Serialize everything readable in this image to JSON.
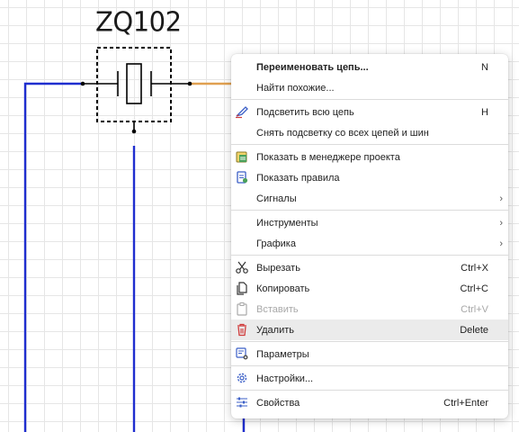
{
  "schematic": {
    "component_designator": "ZQ102",
    "wire_colors": {
      "primary": "#1f2ecf",
      "highlight": "#e0a050"
    }
  },
  "context_menu": {
    "groups": [
      [
        {
          "label": "Переименовать цепь...",
          "shortcut": "N",
          "icon": "",
          "bold": true
        },
        {
          "label": "Найти похожие...",
          "shortcut": "",
          "icon": ""
        }
      ],
      [
        {
          "label": "Подсветить всю цепь",
          "shortcut": "H",
          "icon": "highlighter-icon"
        },
        {
          "label": "Снять подсветку со всех цепей и шин",
          "shortcut": "",
          "icon": ""
        }
      ],
      [
        {
          "label": "Показать в менеджере проекта",
          "shortcut": "",
          "icon": "project-manager-icon"
        },
        {
          "label": "Показать правила",
          "shortcut": "",
          "icon": "rules-icon"
        },
        {
          "label": "Сигналы",
          "shortcut": "",
          "icon": "",
          "submenu": true
        }
      ],
      [
        {
          "label": "Инструменты",
          "shortcut": "",
          "icon": "",
          "submenu": true
        },
        {
          "label": "Графика",
          "shortcut": "",
          "icon": "",
          "submenu": true
        }
      ],
      [
        {
          "label": "Вырезать",
          "shortcut": "Ctrl+X",
          "icon": "scissors-icon"
        },
        {
          "label": "Копировать",
          "shortcut": "Ctrl+C",
          "icon": "copy-icon"
        },
        {
          "label": "Вставить",
          "shortcut": "Ctrl+V",
          "icon": "paste-icon",
          "disabled": true
        },
        {
          "label": "Удалить",
          "shortcut": "Delete",
          "icon": "trash-icon",
          "hovered": true
        }
      ],
      [
        {
          "label": "Параметры",
          "shortcut": "",
          "icon": "parameters-icon"
        }
      ],
      [
        {
          "label": "Настройки...",
          "shortcut": "",
          "icon": "gear-icon"
        }
      ],
      [
        {
          "label": "Свойства",
          "shortcut": "Ctrl+Enter",
          "icon": "sliders-icon"
        }
      ]
    ],
    "submenu_arrow": "›"
  }
}
